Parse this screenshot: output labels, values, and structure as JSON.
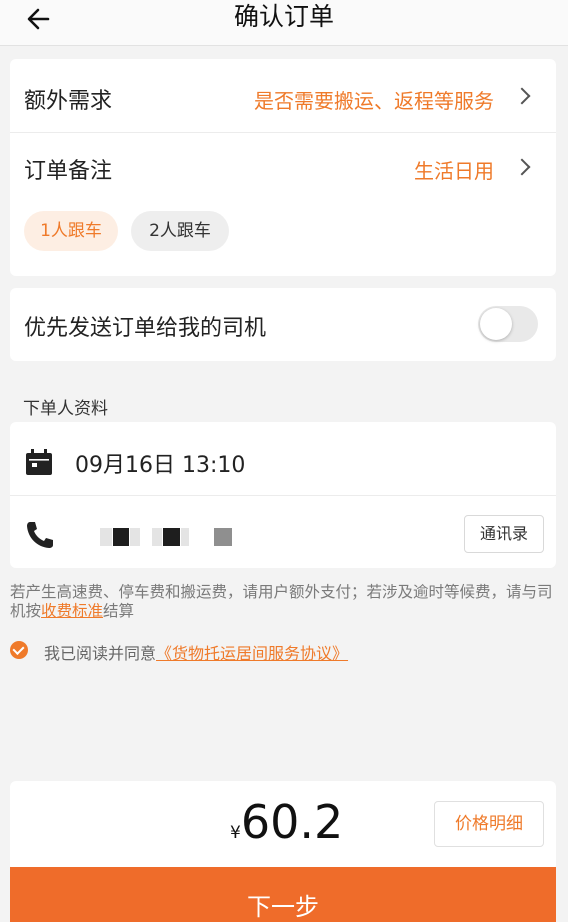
{
  "header": {
    "back_icon": "arrow-left-icon",
    "title": "确认订单"
  },
  "extra_needs": {
    "label": "额外需求",
    "value": "是否需要搬运、返程等服务"
  },
  "order_note": {
    "label": "订单备注",
    "value": "生活日用"
  },
  "riders": {
    "options": [
      "1人跟车",
      "2人跟车"
    ],
    "selected": "1人跟车"
  },
  "priority_driver": {
    "label": "优先发送订单给我的司机",
    "enabled": false
  },
  "orderer": {
    "section_label": "下单人资料",
    "datetime": "09月16日 13:10",
    "contacts_label": "通讯录"
  },
  "notice": {
    "text_before": "若产生高速费、停车费和搬运费，请用户额外支付；若涉及逾时等候费，请与司机按",
    "link": "收费标准",
    "text_after": "结算"
  },
  "agreement": {
    "checked": true,
    "text": "我已阅读并同意",
    "link": "《货物托运居间服务协议》"
  },
  "price": {
    "currency": "¥",
    "amount": "60.2",
    "detail_label": "价格明细"
  },
  "next_button": {
    "label": "下一步"
  },
  "colors": {
    "accent": "#ef7a2a",
    "button": "#ef6c2a",
    "background": "#f3f3f3"
  }
}
